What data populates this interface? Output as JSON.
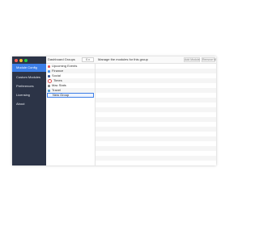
{
  "sidebar": {
    "items": [
      {
        "label": "Module Config",
        "active": true
      },
      {
        "label": "Custom Modules",
        "active": false
      },
      {
        "label": "Preferences",
        "active": false
      },
      {
        "label": "Licensing",
        "active": false
      },
      {
        "label": "About",
        "active": false
      }
    ]
  },
  "toolbar": {
    "group_label": "Dashboard Groups",
    "group_value": "0",
    "manage_text": "Manage the modules for this group",
    "add_label": "Add Module",
    "remove_label": "Remove Module"
  },
  "groups": [
    {
      "label": "Upcoming Events",
      "icon": "calendar-icon"
    },
    {
      "label": "Finance",
      "icon": "finance-icon"
    },
    {
      "label": "Social",
      "icon": "social-icon"
    },
    {
      "label": "Times",
      "icon": "clock-icon"
    },
    {
      "label": "Mac Stats",
      "icon": "stats-icon"
    },
    {
      "label": "Travel",
      "icon": "travel-icon"
    }
  ],
  "new_group": {
    "value": "New Group"
  },
  "colors": {
    "sidebar_bg": "#2c3447",
    "accent": "#3d7ee6",
    "traffic_red": "#ff5f57",
    "traffic_yellow": "#febc2e",
    "traffic_green": "#28c840"
  }
}
